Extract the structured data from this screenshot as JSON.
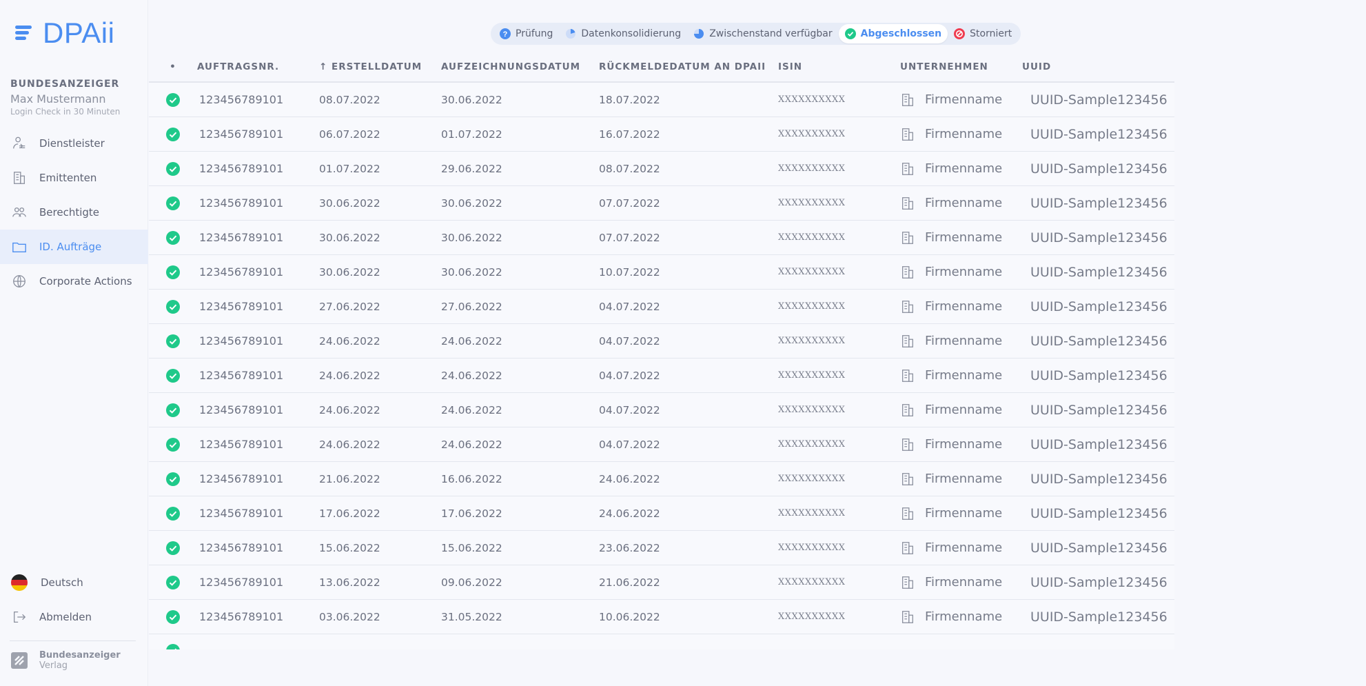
{
  "app": {
    "name": "DPAii",
    "colors": {
      "accent": "#4b8df0",
      "success": "#1fc98a",
      "danger": "#ef3b4f"
    }
  },
  "sidebar": {
    "org_name": "BUNDESANZEIGER",
    "user_name": "Max Mustermann",
    "login_hint": "Login Check in 30 Minuten",
    "items": [
      {
        "label": "Dienstleister",
        "icon": "service-provider-icon"
      },
      {
        "label": "Emittenten",
        "icon": "building-icon"
      },
      {
        "label": "Berechtigte",
        "icon": "users-icon"
      },
      {
        "label": "ID. Aufträge",
        "icon": "folder-icon",
        "active": true
      },
      {
        "label": "Corporate Actions",
        "icon": "globe-gear-icon"
      }
    ],
    "language": "Deutsch",
    "logout": "Abmelden",
    "publisher_name": "Bundesanzeiger",
    "publisher_sub": "Verlag"
  },
  "filters": [
    {
      "label": "Prüfung",
      "icon": "question-icon"
    },
    {
      "label": "Datenkonsolidierung",
      "icon": "pie-small-icon"
    },
    {
      "label": "Zwischenstand verfügbar",
      "icon": "pie-large-icon"
    },
    {
      "label": "Abgeschlossen",
      "icon": "check-icon",
      "active": true
    },
    {
      "label": "Storniert",
      "icon": "cancel-icon"
    }
  ],
  "table": {
    "columns": {
      "status": "•",
      "order_no": "AUFTRAGSNR.",
      "created": "↑ ERSTELLDATUM",
      "recorded": "AUFZEICHNUNGSDATUM",
      "reply": "RÜCKMELDEDATUM AN DPAII",
      "isin": "ISIN",
      "company": "UNTERNEHMEN",
      "uuid": "UUID"
    },
    "rows": [
      {
        "order_no": "123456789101",
        "created": "08.07.2022",
        "recorded": "30.06.2022",
        "reply": "18.07.2022",
        "isin": "XXXXXXXXXX",
        "company": "Firmenname",
        "uuid": "UUID-Sample123456"
      },
      {
        "order_no": "123456789101",
        "created": "06.07.2022",
        "recorded": "01.07.2022",
        "reply": "16.07.2022",
        "isin": "XXXXXXXXXX",
        "company": "Firmenname",
        "uuid": "UUID-Sample123456"
      },
      {
        "order_no": "123456789101",
        "created": "01.07.2022",
        "recorded": "29.06.2022",
        "reply": "08.07.2022",
        "isin": "XXXXXXXXXX",
        "company": "Firmenname",
        "uuid": "UUID-Sample123456"
      },
      {
        "order_no": "123456789101",
        "created": "30.06.2022",
        "recorded": "30.06.2022",
        "reply": "07.07.2022",
        "isin": "XXXXXXXXXX",
        "company": "Firmenname",
        "uuid": "UUID-Sample123456"
      },
      {
        "order_no": "123456789101",
        "created": "30.06.2022",
        "recorded": "30.06.2022",
        "reply": "07.07.2022",
        "isin": "XXXXXXXXXX",
        "company": "Firmenname",
        "uuid": "UUID-Sample123456"
      },
      {
        "order_no": "123456789101",
        "created": "30.06.2022",
        "recorded": "30.06.2022",
        "reply": "10.07.2022",
        "isin": "XXXXXXXXXX",
        "company": "Firmenname",
        "uuid": "UUID-Sample123456"
      },
      {
        "order_no": "123456789101",
        "created": "27.06.2022",
        "recorded": "27.06.2022",
        "reply": "04.07.2022",
        "isin": "XXXXXXXXXX",
        "company": "Firmenname",
        "uuid": "UUID-Sample123456"
      },
      {
        "order_no": "123456789101",
        "created": "24.06.2022",
        "recorded": "24.06.2022",
        "reply": "04.07.2022",
        "isin": "XXXXXXXXXX",
        "company": "Firmenname",
        "uuid": "UUID-Sample123456"
      },
      {
        "order_no": "123456789101",
        "created": "24.06.2022",
        "recorded": "24.06.2022",
        "reply": "04.07.2022",
        "isin": "XXXXXXXXXX",
        "company": "Firmenname",
        "uuid": "UUID-Sample123456"
      },
      {
        "order_no": "123456789101",
        "created": "24.06.2022",
        "recorded": "24.06.2022",
        "reply": "04.07.2022",
        "isin": "XXXXXXXXXX",
        "company": "Firmenname",
        "uuid": "UUID-Sample123456"
      },
      {
        "order_no": "123456789101",
        "created": "24.06.2022",
        "recorded": "24.06.2022",
        "reply": "04.07.2022",
        "isin": "XXXXXXXXXX",
        "company": "Firmenname",
        "uuid": "UUID-Sample123456"
      },
      {
        "order_no": "123456789101",
        "created": "21.06.2022",
        "recorded": "16.06.2022",
        "reply": "24.06.2022",
        "isin": "XXXXXXXXXX",
        "company": "Firmenname",
        "uuid": "UUID-Sample123456"
      },
      {
        "order_no": "123456789101",
        "created": "17.06.2022",
        "recorded": "17.06.2022",
        "reply": "24.06.2022",
        "isin": "XXXXXXXXXX",
        "company": "Firmenname",
        "uuid": "UUID-Sample123456"
      },
      {
        "order_no": "123456789101",
        "created": "15.06.2022",
        "recorded": "15.06.2022",
        "reply": "23.06.2022",
        "isin": "XXXXXXXXXX",
        "company": "Firmenname",
        "uuid": "UUID-Sample123456"
      },
      {
        "order_no": "123456789101",
        "created": "13.06.2022",
        "recorded": "09.06.2022",
        "reply": "21.06.2022",
        "isin": "XXXXXXXXXX",
        "company": "Firmenname",
        "uuid": "UUID-Sample123456"
      },
      {
        "order_no": "123456789101",
        "created": "03.06.2022",
        "recorded": "31.05.2022",
        "reply": "10.06.2022",
        "isin": "XXXXXXXXXX",
        "company": "Firmenname",
        "uuid": "UUID-Sample123456"
      }
    ]
  }
}
